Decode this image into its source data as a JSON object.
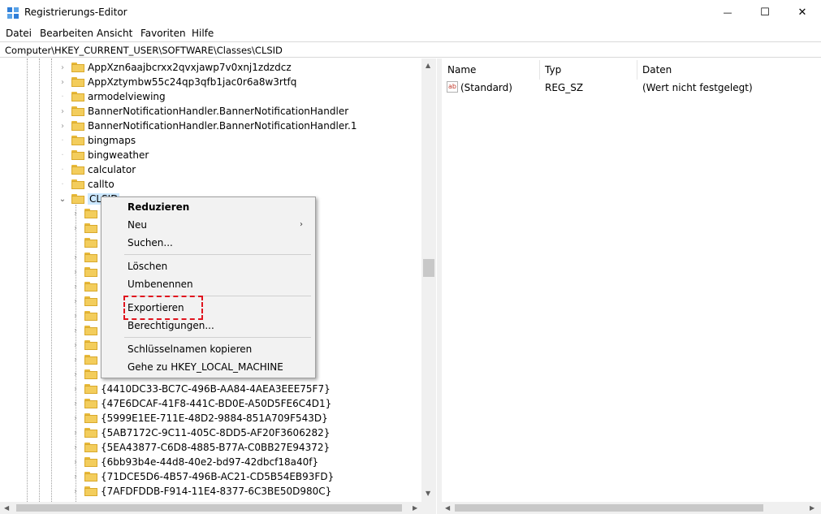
{
  "window": {
    "title": "Registrierungs-Editor",
    "controls": {
      "minimize": "—",
      "maximize": "☐",
      "close": "✕"
    }
  },
  "menu": [
    "Datei",
    "Bearbeiten",
    "Ansicht",
    "Favoriten",
    "Hilfe"
  ],
  "address": "Computer\\HKEY_CURRENT_USER\\SOFTWARE\\Classes\\CLSID",
  "tree": {
    "keys": [
      "AppXzn6aajbcrxx2qvxjawp7v0xnj1zdzdcz",
      "AppXztymbw55c24qp3qfb1jac0r6a8w3rtfq",
      "armodelviewing",
      "BannerNotificationHandler.BannerNotificationHandler",
      "BannerNotificationHandler.BannerNotificationHandler.1",
      "bingmaps",
      "bingweather",
      "calculator",
      "callto",
      "CLSID"
    ],
    "clsid_children": [
      "{4410DC33-BC7C-496B-AA84-4AEA3EEE75F7}",
      "{47E6DCAF-41F8-441C-BD0E-A50D5FE6C4D1}",
      "{5999E1EE-711E-48D2-9884-851A709F543D}",
      "{5AB7172C-9C11-405C-8DD5-AF20F3606282}",
      "{5EA43877-C6D8-4885-B77A-C0BB27E94372}",
      "{6bb93b4e-44d8-40e2-bd97-42dbcf18a40f}",
      "{71DCE5D6-4B57-496B-AC21-CD5B54EB93FD}",
      "{7AFDFDDB-F914-11E4-8377-6C3BE50D980C}"
    ]
  },
  "list": {
    "columns": [
      "Name",
      "Typ",
      "Daten"
    ],
    "rows": [
      {
        "name": "(Standard)",
        "type": "REG_SZ",
        "data": "(Wert nicht festgelegt)",
        "icon": "ab"
      }
    ]
  },
  "context_menu": {
    "items": [
      "Reduzieren",
      "Neu",
      "Suchen...",
      "Löschen",
      "Umbenennen",
      "Exportieren",
      "Berechtigungen...",
      "Schlüsselnamen kopieren",
      "Gehe zu HKEY_LOCAL_MACHINE"
    ],
    "submenu_arrow": "›"
  },
  "colors": {
    "selection": "#cce8ff",
    "highlight": "#e0141e",
    "folder": "#f3cd5c"
  }
}
